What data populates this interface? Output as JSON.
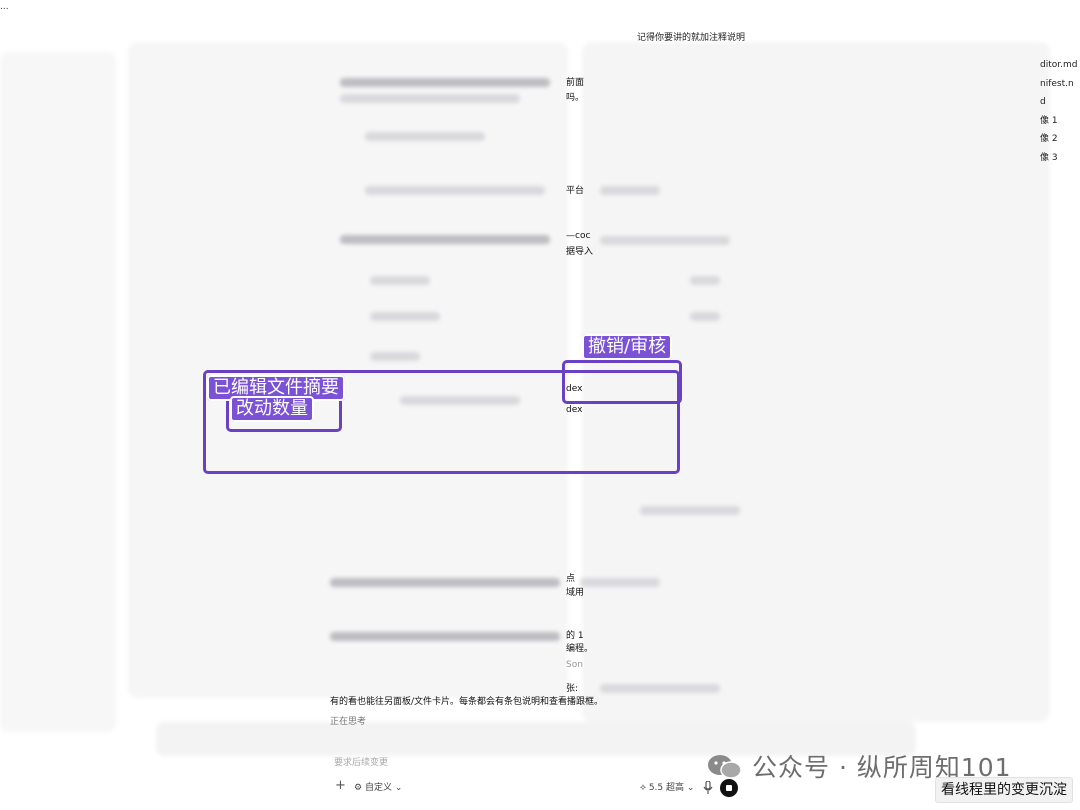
{
  "top_note": "记得你要讲的就加注释说明",
  "right_sidebar_files": [
    "ditor.md",
    "nifest.n",
    "d",
    "像 1",
    "像 2",
    "像 3"
  ],
  "fragments": {
    "f1": "前面",
    "f2": "吗。",
    "f3": "平台",
    "f4": "—coc",
    "f5": "据导入",
    "f6": "dex",
    "f7": "dex",
    "f8": "点",
    "f9": "域用",
    "f10": "的 1",
    "f11": "编程。",
    "f12": "Son",
    "f13": "张:",
    "f14": "有的看也能往另面板/文件卡片。每条都会有条包说明和查看播跟框。",
    "f15": "正在思考",
    "f16": "要求后续变更"
  },
  "composer_bar": {
    "custom_label": "自定义",
    "model_label": "5.5 超高"
  },
  "annotations": {
    "edited_summary": "已编辑文件摘要",
    "change_count": "改动数量",
    "undo_review": "撤销/审核"
  },
  "watermark": "公众号 · 纵所周知101",
  "caption": "看线程里的变更沉淀",
  "colors": {
    "annotation": "#6a40c4",
    "tag_bg": "#7b52d6"
  }
}
